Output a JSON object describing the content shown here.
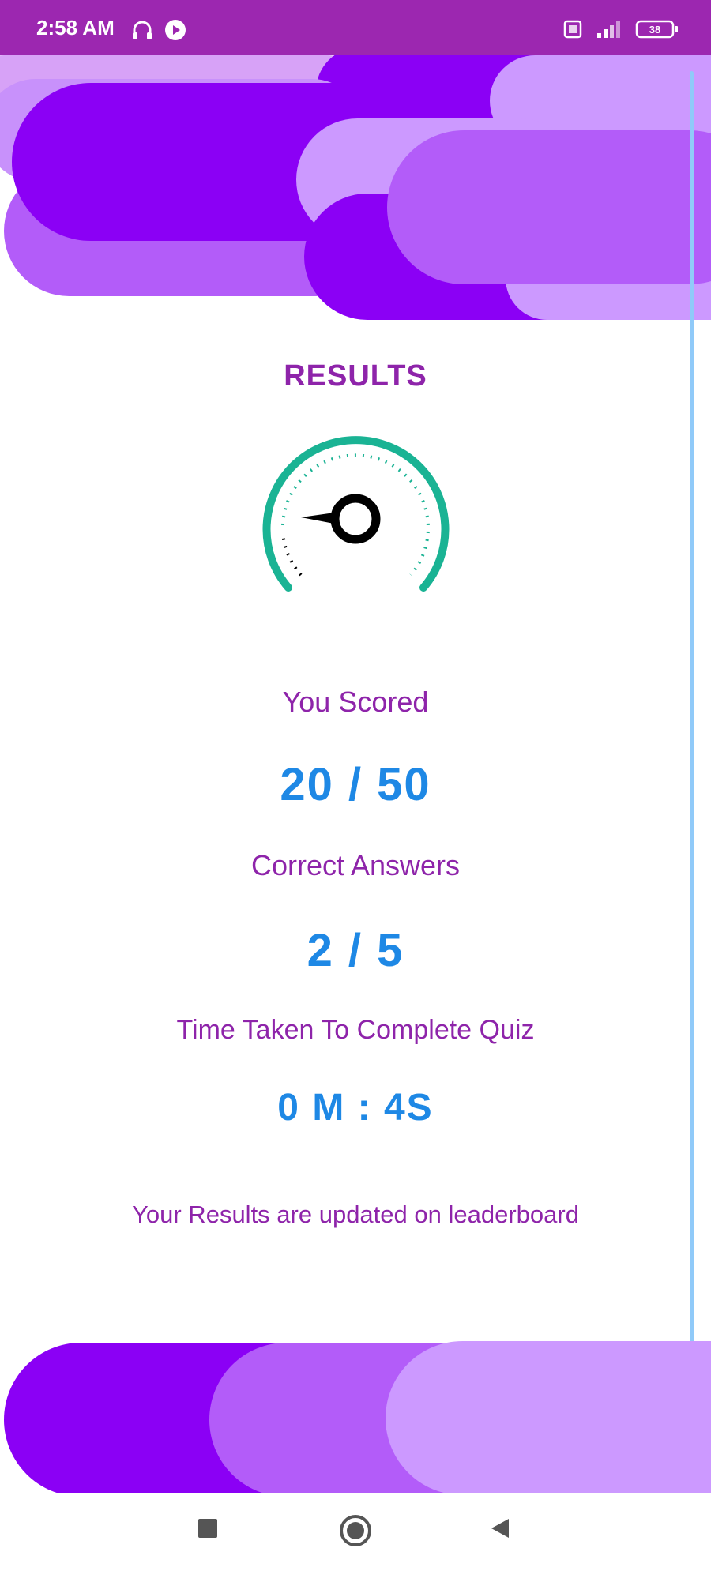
{
  "status_bar": {
    "time": "2:58 AM",
    "left_icons": [
      "headphones-icon",
      "play-icon"
    ],
    "right_icons": [
      "sim-icon",
      "signal-icon",
      "battery-icon"
    ],
    "battery_level": "38"
  },
  "colors": {
    "status_bar": "#9c27b0",
    "accent_purple": "#8e24aa",
    "value_blue": "#1e88e5",
    "gauge_teal": "#1ab394",
    "scroll_indicator": "#90caf9"
  },
  "results": {
    "title": "RESULTS",
    "you_scored_label": "You Scored",
    "score": "20 / 50",
    "correct_label": "Correct Answers",
    "correct_value": "2 / 5",
    "time_label": "Time Taken To Complete Quiz",
    "time_value": "0 M : 4S",
    "leaderboard_note": "Your Results are updated on leaderboard"
  },
  "nav_bar": {
    "buttons": [
      "recent-apps-icon",
      "home-icon",
      "back-icon"
    ]
  }
}
